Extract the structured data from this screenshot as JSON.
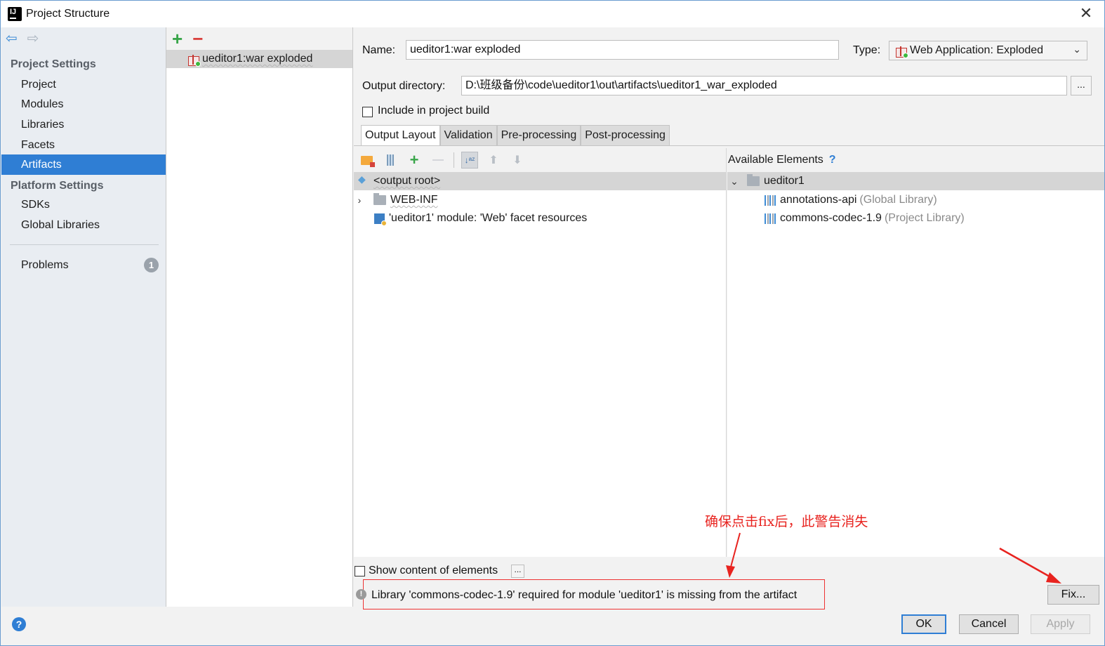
{
  "window": {
    "title": "Project Structure"
  },
  "nav": {
    "project_settings": "Project Settings",
    "items_project": [
      "Project",
      "Modules",
      "Libraries",
      "Facets",
      "Artifacts"
    ],
    "platform_settings": "Platform Settings",
    "items_platform": [
      "SDKs",
      "Global Libraries"
    ],
    "problems": "Problems",
    "problems_count": "1",
    "selected": "Artifacts"
  },
  "artifacts": {
    "items": [
      "ueditor1:war exploded"
    ]
  },
  "detail": {
    "name_label": "Name:",
    "name_value": "ueditor1:war exploded",
    "type_label": "Type:",
    "type_value": "Web Application: Exploded",
    "output_label": "Output directory:",
    "output_value": "D:\\班级备份\\code\\ueditor1\\out\\artifacts\\ueditor1_war_exploded",
    "browse": "...",
    "include_label": "Include in project build",
    "include_checked": false,
    "tabs": [
      "Output Layout",
      "Validation",
      "Pre-processing",
      "Post-processing"
    ],
    "active_tab": "Output Layout"
  },
  "layout_tree": [
    {
      "label": "<output root>",
      "kind": "root"
    },
    {
      "label": "WEB-INF",
      "kind": "folder"
    },
    {
      "label": "'ueditor1' module: 'Web' facet resources",
      "kind": "module"
    }
  ],
  "available": {
    "header": "Available Elements",
    "help": "?",
    "module": "ueditor1",
    "libraries": [
      {
        "name": "annotations-api",
        "scope": "(Global Library)"
      },
      {
        "name": "commons-codec-1.9",
        "scope": "(Project Library)"
      }
    ]
  },
  "bottom": {
    "show_content_label": "Show content of elements",
    "show_content_checked": false,
    "ellipsis": "...",
    "warning": "Library 'commons-codec-1.9' required for module 'ueditor1' is missing from the artifact",
    "fix": "Fix...",
    "annotation": "确保点击fix后，此警告消失"
  },
  "footer": {
    "ok": "OK",
    "cancel": "Cancel",
    "apply": "Apply"
  },
  "colors": {
    "accent": "#2f7ed4",
    "annotation": "#e8231f"
  }
}
